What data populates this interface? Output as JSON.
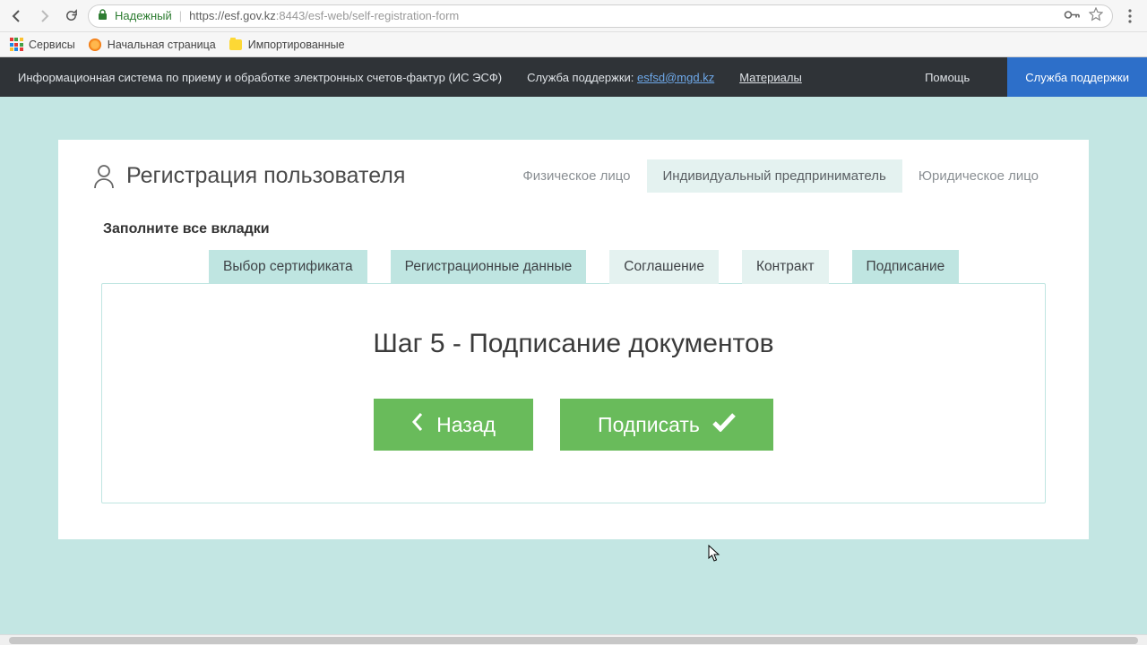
{
  "browser": {
    "secure_label": "Надежный",
    "url_host": "https://esf.gov.kz",
    "url_port_path": ":8443/esf-web/self-registration-form"
  },
  "bookmarks": {
    "services": "Сервисы",
    "start_page": "Начальная страница",
    "imported": "Импортированные"
  },
  "header": {
    "title": "Информационная система по приему и обработке электронных счетов-фактур (ИС ЭСФ)",
    "support_label": "Служба поддержки:",
    "support_email": "esfsd@mgd.kz",
    "materials": "Материалы",
    "help": "Помощь",
    "support_button": "Служба поддержки"
  },
  "card": {
    "title": "Регистрация пользователя",
    "type_tabs": {
      "individual": "Физическое лицо",
      "entrepreneur": "Индивидуальный предприниматель",
      "legal": "Юридическое лицо"
    },
    "instruction": "Заполните все вкладки",
    "steps": {
      "cert": "Выбор сертификата",
      "reg": "Регистрационные данные",
      "agree": "Соглашение",
      "contract": "Контракт",
      "sign": "Подписание"
    },
    "panel": {
      "title": "Шаг 5 - Подписание документов",
      "back": "Назад",
      "sign": "Подписать"
    }
  }
}
